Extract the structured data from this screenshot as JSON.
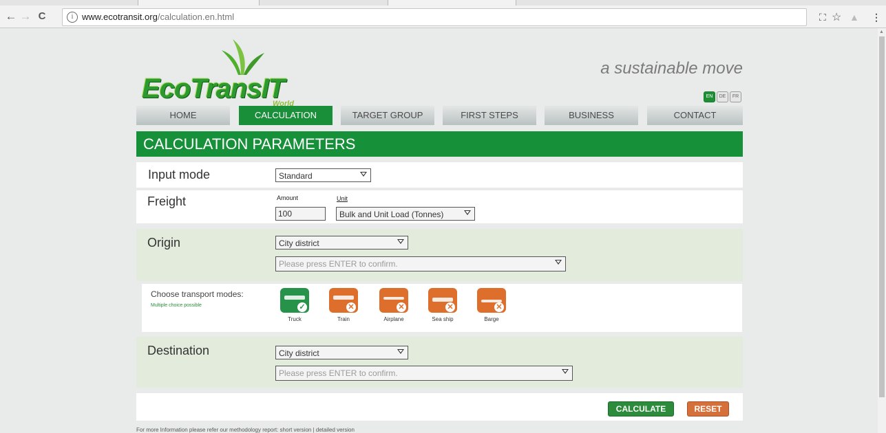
{
  "browser": {
    "url_host": "www.ecotransit.org",
    "url_path": "/calculation.en.html",
    "back_icon": "back-arrow-icon",
    "forward_icon": "forward-arrow-icon",
    "reload_icon": "reload-icon",
    "back_glyph": "←",
    "forward_glyph": "→",
    "reload_glyph": "C",
    "info_glyph": "i",
    "translate_glyph": "⛶",
    "star_glyph": "☆",
    "ext_glyph": "▲",
    "menu_glyph": "⋮"
  },
  "header": {
    "logo_text": "EcoTransIT",
    "logo_subtext": "World",
    "tagline": "a sustainable move",
    "languages": [
      "EN",
      "DE",
      "FR"
    ],
    "active_language": "EN"
  },
  "menu": {
    "items": [
      "HOME",
      "CALCULATION",
      "TARGET GROUP",
      "FIRST STEPS",
      "BUSINESS",
      "CONTACT"
    ],
    "active": "CALCULATION"
  },
  "section_title": "CALCULATION PARAMETERS",
  "input_mode": {
    "label": "Input mode",
    "value": "Standard"
  },
  "freight": {
    "label": "Freight",
    "amount_label": "Amount",
    "amount_value": "100",
    "unit_label": "Unit",
    "unit_value": "Bulk and Unit Load (Tonnes)"
  },
  "origin": {
    "label": "Origin",
    "type_value": "City district",
    "location_placeholder": "Please press ENTER to confirm."
  },
  "transport": {
    "label": "Choose transport modes:",
    "hint": "Multiple choice possible",
    "modes": [
      {
        "name": "Truck",
        "selected": true
      },
      {
        "name": "Train",
        "selected": false
      },
      {
        "name": "Airplane",
        "selected": false
      },
      {
        "name": "Sea ship",
        "selected": false
      },
      {
        "name": "Barge",
        "selected": false
      }
    ],
    "check_glyph": "✓",
    "cross_glyph": "✕",
    "colors": {
      "selected": "#27924a",
      "unselected": "#dd6e2b"
    }
  },
  "destination": {
    "label": "Destination",
    "type_value": "City district",
    "location_placeholder": "Please press ENTER to confirm."
  },
  "actions": {
    "calculate": "CALCULATE",
    "reset": "RESET"
  },
  "footnote": "For more Information please refer our methodology report: short version | detailed version",
  "colors": {
    "brand_green": "#17903a",
    "accent_orange": "#dd6e2b",
    "panel_green": "#e3ecdc"
  }
}
